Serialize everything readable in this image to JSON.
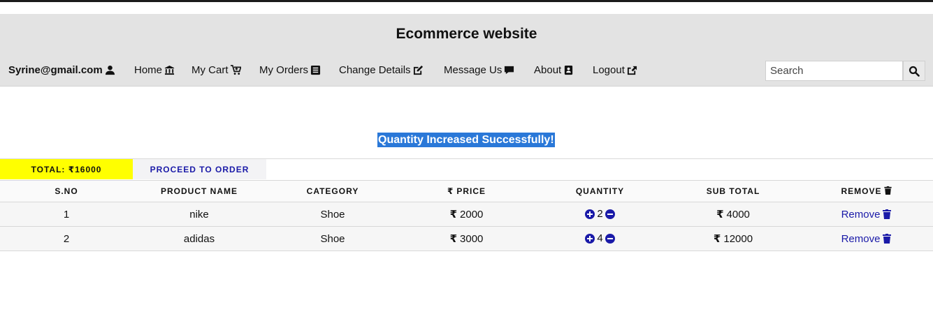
{
  "header": {
    "title": "Ecommerce website"
  },
  "nav": {
    "user": "Syrine@gmail.com",
    "items": [
      {
        "label": "Home",
        "icon": "bank-icon"
      },
      {
        "label": "My Cart",
        "icon": "cart-icon"
      },
      {
        "label": "My Orders",
        "icon": "list-icon"
      },
      {
        "label": "Change Details",
        "icon": "edit-icon"
      },
      {
        "label": "Message Us",
        "icon": "comment-icon"
      },
      {
        "label": "About",
        "icon": "address-book-icon"
      },
      {
        "label": "Logout",
        "icon": "share-icon"
      }
    ]
  },
  "search": {
    "placeholder": "Search",
    "value": ""
  },
  "flash": {
    "message": "Quantity Increased Successfully!"
  },
  "summary": {
    "total_label": "TOTAL: ₹16000",
    "order_label": "PROCEED TO ORDER"
  },
  "table": {
    "headers": {
      "sno": "S.NO",
      "name": "PRODUCT NAME",
      "category": "CATEGORY",
      "price": "PRICE",
      "quantity": "QUANTITY",
      "subtotal": "SUB TOTAL",
      "remove": "REMOVE"
    },
    "currency": "₹",
    "rows": [
      {
        "sno": "1",
        "name": "nike",
        "category": "Shoe",
        "price": "2000",
        "qty": "2",
        "subtotal": "4000",
        "remove": "Remove"
      },
      {
        "sno": "2",
        "name": "adidas",
        "category": "Shoe",
        "price": "3000",
        "qty": "4",
        "subtotal": "12000",
        "remove": "Remove"
      }
    ]
  },
  "colors": {
    "header_bg": "#e3e3e3",
    "flash_bg": "#2a78d8",
    "total_bg": "#ffff00",
    "link": "#1a1aa8"
  }
}
